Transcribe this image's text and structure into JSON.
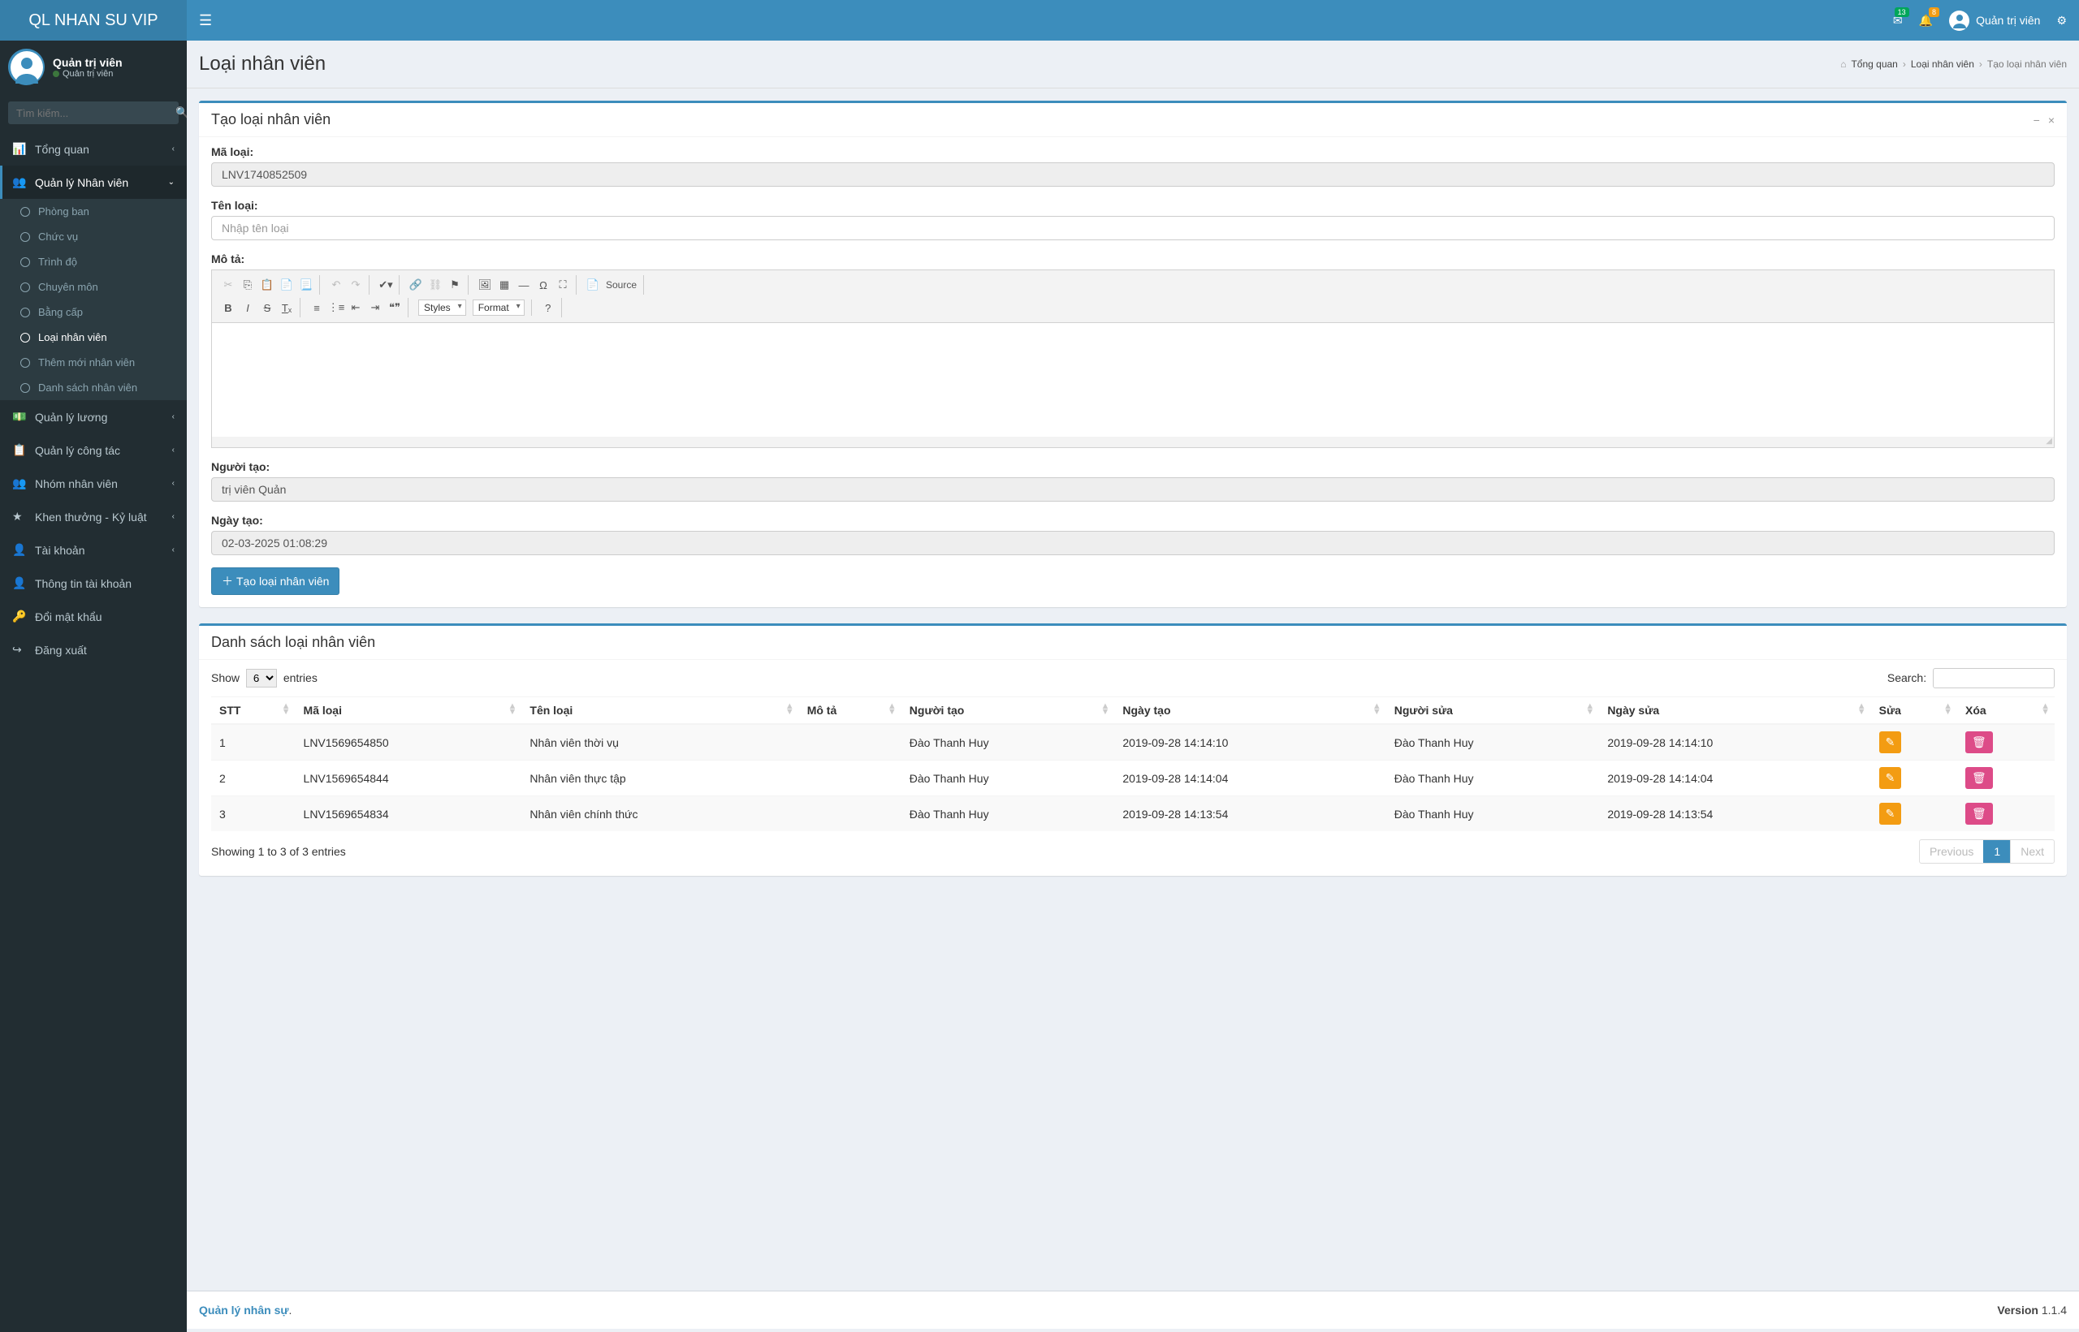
{
  "app": {
    "name": "QL NHAN SU VIP"
  },
  "user": {
    "name": "Quản trị viên",
    "role": "Quản trị viên"
  },
  "notifications": {
    "messages": "13",
    "alerts": "8"
  },
  "search": {
    "placeholder": "Tìm kiếm..."
  },
  "nav": {
    "tongquan": "Tổng quan",
    "ql_nhanvien": "Quản lý Nhân viên",
    "phongban": "Phòng ban",
    "chucvu": "Chức vụ",
    "trinhdo": "Trình độ",
    "chuyenmon": "Chuyên môn",
    "bangcap": "Bằng cấp",
    "loainhanvien": "Loại nhân viên",
    "themmoi": "Thêm mới nhân viên",
    "danhsach": "Danh sách nhân viên",
    "ql_luong": "Quản lý lương",
    "ql_congtac": "Quản lý công tác",
    "nhom": "Nhóm nhân viên",
    "khenthuong": "Khen thưởng - Kỷ luật",
    "taikhoan": "Tài khoản",
    "thongtin": "Thông tin tài khoản",
    "doimatkhau": "Đổi mật khẩu",
    "dangxuat": "Đăng xuất"
  },
  "page": {
    "title": "Loại nhân viên",
    "breadcrumb": {
      "home": "Tổng quan",
      "parent": "Loại nhân viên",
      "current": "Tạo loại nhân viên"
    }
  },
  "form": {
    "title": "Tạo loại nhân viên",
    "ma_loai_label": "Mã loại:",
    "ma_loai_value": "LNV1740852509",
    "ten_loai_label": "Tên loại:",
    "ten_loai_placeholder": "Nhập tên loại",
    "mo_ta_label": "Mô tả:",
    "nguoi_tao_label": "Người tạo:",
    "nguoi_tao_value": "trị viên Quản",
    "ngay_tao_label": "Ngày tạo:",
    "ngay_tao_value": "02-03-2025 01:08:29",
    "submit": "Tạo loại nhân viên"
  },
  "editor": {
    "styles": "Styles",
    "format": "Format",
    "source": "Source"
  },
  "list": {
    "title": "Danh sách loại nhân viên",
    "show": "Show",
    "entries": "entries",
    "length": "6",
    "search": "Search:",
    "info": "Showing 1 to 3 of 3 entries",
    "prev": "Previous",
    "next": "Next",
    "page": "1",
    "cols": {
      "stt": "STT",
      "ma": "Mã loại",
      "ten": "Tên loại",
      "mota": "Mô tả",
      "nguoitao": "Người tạo",
      "ngaytao": "Ngày tạo",
      "nguoisua": "Người sửa",
      "ngaysua": "Ngày sửa",
      "sua": "Sửa",
      "xoa": "Xóa"
    },
    "rows": [
      {
        "stt": "1",
        "ma": "LNV1569654850",
        "ten": "Nhân viên thời vụ",
        "mota": "",
        "nguoitao": "Đào Thanh Huy",
        "ngaytao": "2019-09-28 14:14:10",
        "nguoisua": "Đào Thanh Huy",
        "ngaysua": "2019-09-28 14:14:10"
      },
      {
        "stt": "2",
        "ma": "LNV1569654844",
        "ten": "Nhân viên thực tập",
        "mota": "",
        "nguoitao": "Đào Thanh Huy",
        "ngaytao": "2019-09-28 14:14:04",
        "nguoisua": "Đào Thanh Huy",
        "ngaysua": "2019-09-28 14:14:04"
      },
      {
        "stt": "3",
        "ma": "LNV1569654834",
        "ten": "Nhân viên chính thức",
        "mota": "",
        "nguoitao": "Đào Thanh Huy",
        "ngaytao": "2019-09-28 14:13:54",
        "nguoisua": "Đào Thanh Huy",
        "ngaysua": "2019-09-28 14:13:54"
      }
    ]
  },
  "footer": {
    "left": "Quản lý nhân sự",
    "dot": ".",
    "version_label": "Version",
    "version": "1.1.4"
  }
}
